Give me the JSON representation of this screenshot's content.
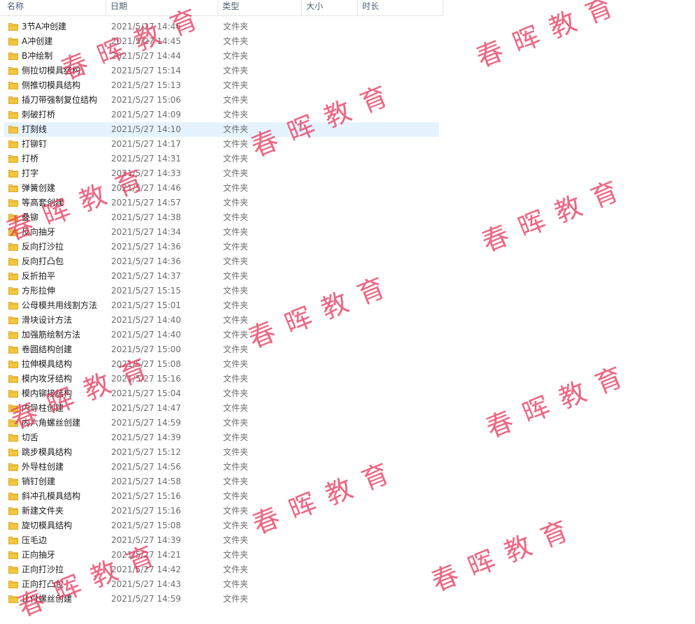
{
  "columns": {
    "name": "名称",
    "date": "日期",
    "type": "类型",
    "size": "大小",
    "duration": "时长"
  },
  "selected_index": 7,
  "rows": [
    {
      "name": "3节A冲创建",
      "date": "2021/5/27 14:46",
      "type": "文件夹"
    },
    {
      "name": "A冲创建",
      "date": "2021/5/27 14:45",
      "type": "文件夹"
    },
    {
      "name": "B冲绘制",
      "date": "2021/5/27 14:44",
      "type": "文件夹"
    },
    {
      "name": "侧拉切模具结构",
      "date": "2021/5/27 15:14",
      "type": "文件夹"
    },
    {
      "name": "侧推切模具结构",
      "date": "2021/5/27 15:13",
      "type": "文件夹"
    },
    {
      "name": "插刀带强制复位结构",
      "date": "2021/5/27 15:06",
      "type": "文件夹"
    },
    {
      "name": "刺破打桥",
      "date": "2021/5/27 14:09",
      "type": "文件夹"
    },
    {
      "name": "打刻线",
      "date": "2021/5/27 14:10",
      "type": "文件夹"
    },
    {
      "name": "打铆钉",
      "date": "2021/5/27 14:17",
      "type": "文件夹"
    },
    {
      "name": "打桥",
      "date": "2021/5/27 14:31",
      "type": "文件夹"
    },
    {
      "name": "打字",
      "date": "2021/5/27 14:33",
      "type": "文件夹"
    },
    {
      "name": "弹簧创建",
      "date": "2021/5/27 14:46",
      "type": "文件夹"
    },
    {
      "name": "等高套创建",
      "date": "2021/5/27 14:57",
      "type": "文件夹"
    },
    {
      "name": "叠铆",
      "date": "2021/5/27 14:38",
      "type": "文件夹"
    },
    {
      "name": "反向抽牙",
      "date": "2021/5/27 14:34",
      "type": "文件夹"
    },
    {
      "name": "反向打沙拉",
      "date": "2021/5/27 14:36",
      "type": "文件夹"
    },
    {
      "name": "反向打凸包",
      "date": "2021/5/27 14:36",
      "type": "文件夹"
    },
    {
      "name": "反折拍平",
      "date": "2021/5/27 14:37",
      "type": "文件夹"
    },
    {
      "name": "方形拉伸",
      "date": "2021/5/27 15:15",
      "type": "文件夹"
    },
    {
      "name": "公母模共用线割方法",
      "date": "2021/5/27 15:01",
      "type": "文件夹"
    },
    {
      "name": "滑块设计方法",
      "date": "2021/5/27 14:40",
      "type": "文件夹"
    },
    {
      "name": "加强筋绘制方法",
      "date": "2021/5/27 14:40",
      "type": "文件夹"
    },
    {
      "name": "卷圆结构创建",
      "date": "2021/5/27 15:00",
      "type": "文件夹"
    },
    {
      "name": "拉伸模具结构",
      "date": "2021/5/27 15:08",
      "type": "文件夹"
    },
    {
      "name": "模内攻牙结构",
      "date": "2021/5/27 15:16",
      "type": "文件夹"
    },
    {
      "name": "模内铆接结构",
      "date": "2021/5/27 15:04",
      "type": "文件夹"
    },
    {
      "name": "内导柱创建",
      "date": "2021/5/27 14:47",
      "type": "文件夹"
    },
    {
      "name": "内六角螺丝创建",
      "date": "2021/5/27 14:59",
      "type": "文件夹"
    },
    {
      "name": "切舌",
      "date": "2021/5/27 14:39",
      "type": "文件夹"
    },
    {
      "name": "跳步模具结构",
      "date": "2021/5/27 15:12",
      "type": "文件夹"
    },
    {
      "name": "外导柱创建",
      "date": "2021/5/27 14:56",
      "type": "文件夹"
    },
    {
      "name": "销钉创建",
      "date": "2021/5/27 14:58",
      "type": "文件夹"
    },
    {
      "name": "斜冲孔模具结构",
      "date": "2021/5/27 15:16",
      "type": "文件夹"
    },
    {
      "name": "新建文件夹",
      "date": "2021/5/27 15:16",
      "type": "文件夹"
    },
    {
      "name": "旋切模具结构",
      "date": "2021/5/27 15:08",
      "type": "文件夹"
    },
    {
      "name": "压毛边",
      "date": "2021/5/27 14:39",
      "type": "文件夹"
    },
    {
      "name": "正向抽牙",
      "date": "2021/5/27 14:21",
      "type": "文件夹"
    },
    {
      "name": "正向打沙拉",
      "date": "2021/5/27 14:42",
      "type": "文件夹"
    },
    {
      "name": "正向打凸包",
      "date": "2021/5/27 14:43",
      "type": "文件夹"
    },
    {
      "name": "止付螺丝创建",
      "date": "2021/5/27 14:59",
      "type": "文件夹"
    }
  ],
  "watermark": "春晖教育",
  "colors": {
    "folder": "#f3c640",
    "watermark": "#e83c5f",
    "selection": "#e5f3ff"
  },
  "icon": "folder-icon"
}
